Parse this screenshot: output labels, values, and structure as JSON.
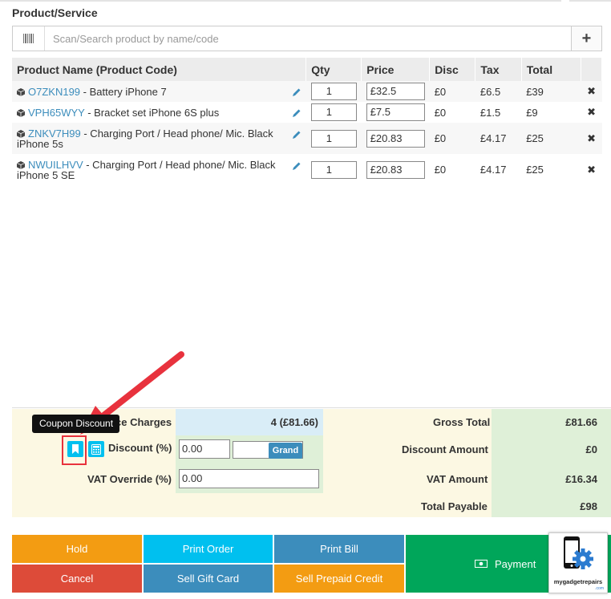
{
  "section_title": "Product/Service",
  "search": {
    "placeholder": "Scan/Search product by name/code",
    "add_label": "+"
  },
  "table": {
    "headers": {
      "name": "Product Name (Product Code)",
      "qty": "Qty",
      "price": "Price",
      "disc": "Disc",
      "tax": "Tax",
      "total": "Total"
    },
    "rows": [
      {
        "code": "O7ZKN199",
        "name": " - Battery iPhone 7",
        "qty": "1",
        "price": "£32.5",
        "disc": "£0",
        "tax": "£6.5",
        "total": "£39"
      },
      {
        "code": "VPH65WYY",
        "name": " - Bracket set iPhone 6S plus",
        "qty": "1",
        "price": "£7.5",
        "disc": "£0",
        "tax": "£1.5",
        "total": "£9"
      },
      {
        "code": "ZNKV7H99",
        "name": " - Charging Port / Head phone/ Mic. Black iPhone 5s",
        "qty": "1",
        "price": "£20.83",
        "disc": "£0",
        "tax": "£4.17",
        "total": "£25"
      },
      {
        "code": "NWUILHVV",
        "name": " - Charging Port / Head phone/ Mic. Black iPhone 5 SE",
        "qty": "1",
        "price": "£20.83",
        "disc": "£0",
        "tax": "£4.17",
        "total": "£25"
      }
    ],
    "delete_symbol": "✖"
  },
  "summary": {
    "items_label": "ce Charges",
    "items_value": "4 (£81.66)",
    "discount_label": "Discount (%)",
    "discount_value": "0.00",
    "grand_label": "Grand",
    "vat_override_label": "VAT Override (%)",
    "vat_override_value": "0.00",
    "gross_total_label": "Gross Total",
    "gross_total_value": "£81.66",
    "discount_amount_label": "Discount Amount",
    "discount_amount_value": "£0",
    "vat_amount_label": "VAT Amount",
    "vat_amount_value": "£16.34",
    "total_payable_label": "Total Payable",
    "total_payable_value": "£98"
  },
  "tooltip": "Coupon Discount",
  "buttons": {
    "hold": "Hold",
    "print_order": "Print Order",
    "print_bill": "Print Bill",
    "payment": "Payment",
    "cancel": "Cancel",
    "sell_gift_card": "Sell Gift Card",
    "sell_prepaid_credit": "Sell Prepaid Credit"
  },
  "logo": {
    "text": "mygadgetrepairs",
    "suffix": ".com"
  },
  "colors": {
    "hold": "#f39c12",
    "print_order": "#00c0ef",
    "print_bill": "#3c8dbc",
    "payment": "#00a65a",
    "cancel": "#dd4b39",
    "sell_gift_card": "#3c8dbc",
    "sell_prepaid_credit": "#f39c12",
    "annotation_red": "#e8323d"
  },
  "icons": [
    "barcode-icon",
    "cube-icon",
    "pencil-icon",
    "bookmark-icon",
    "calculator-icon",
    "money-icon",
    "phone-gear-logo"
  ]
}
